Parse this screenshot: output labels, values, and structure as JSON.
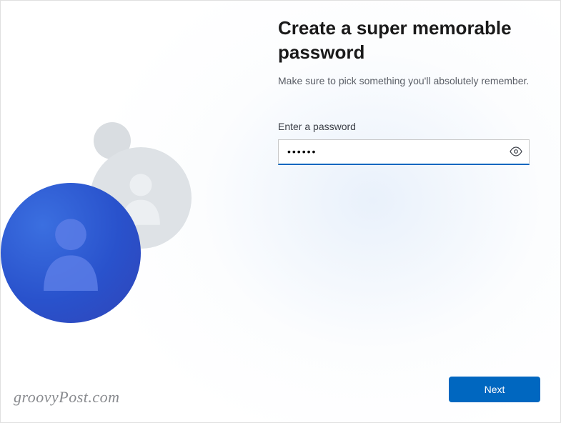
{
  "header": {
    "title": "Create a super memorable password",
    "subtitle": "Make sure to pick something you'll absolutely remember."
  },
  "form": {
    "password_label": "Enter a password",
    "password_value": "••••••"
  },
  "actions": {
    "next_label": "Next"
  },
  "watermark": {
    "text": "groovyPost.com"
  }
}
